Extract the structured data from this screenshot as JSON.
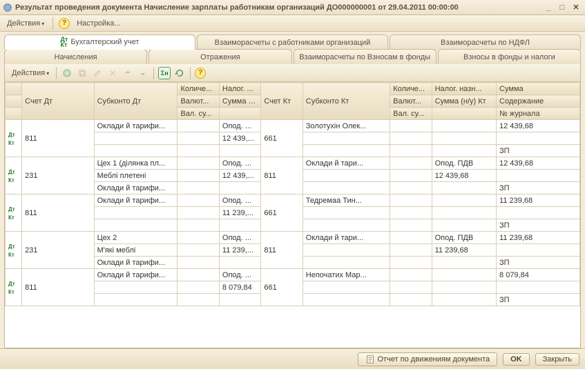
{
  "window": {
    "title": "Результат проведения документа Начисление зарплаты работникам организаций ДО000000001 от 29.04.2011 00:00:00"
  },
  "menubar": {
    "actions": "Действия",
    "settings": "Настройка..."
  },
  "tabs_top": {
    "accounting": "Бухгалтерский учет",
    "settlements": "Взаиморасчеты с работниками организаций",
    "ndfl": "Взаиморасчеты по НДФЛ"
  },
  "tabs_bottom": {
    "accruals": "Начисления",
    "reflections": "Отражения",
    "funds": "Взаиморасчеты по Взносам в фонды",
    "taxes": "Взносы в фонды и налоги"
  },
  "grid_toolbar": {
    "actions": "Действия"
  },
  "headers": {
    "r1": {
      "acct_dt": "Счет Дт",
      "sub_dt": "Субконто Дт",
      "qty": "Количе...",
      "tax": "Налог. ...",
      "acct_kt": "Счет Кт",
      "sub_kt": "Субконто Кт",
      "qty_k": "Количе...",
      "tax_k": "Налог. назн...",
      "sum": "Сумма"
    },
    "r2": {
      "cur_dt": "Валют...",
      "sum_nu_dt": "Сумма (н/у) Дт",
      "cur_kt": "Валют...",
      "sum_nu_kt": "Сумма (н/у) Кт",
      "content": "Содержание"
    },
    "r3": {
      "val_su_dt": "Вал. су...",
      "val_su_kt": "Вал. су...",
      "journal": "№ журнала"
    }
  },
  "rows": [
    {
      "acct_dt": "811",
      "sub_dt1": "Оклади й тарифи...",
      "sub_dt2": "",
      "sub_dt3": "",
      "tax1": "Опод. ...",
      "sum_nu_dt": "12 439,...",
      "acct_kt": "661",
      "sub_kt1": "Золотухін Олек...",
      "tax_k1": "",
      "sum_nu_kt": "",
      "sum": "12 439,68",
      "content": "",
      "journal": "ЗП"
    },
    {
      "acct_dt": "231",
      "sub_dt1": "Цех 1 (ділянка пл...",
      "sub_dt2": "Меблі плетені",
      "sub_dt3": "Оклади й тарифи...",
      "tax1": "Опод. ...",
      "sum_nu_dt": "12 439,...",
      "acct_kt": "811",
      "sub_kt1": "Оклади й тари...",
      "tax_k1": "Опод. ПДВ",
      "sum_nu_kt": "12 439,68",
      "sum": "12 439,68",
      "content": "",
      "journal": "ЗП"
    },
    {
      "acct_dt": "811",
      "sub_dt1": "Оклади й тарифи...",
      "sub_dt2": "",
      "sub_dt3": "",
      "tax1": "Опод. ...",
      "sum_nu_dt": "11 239,...",
      "acct_kt": "661",
      "sub_kt1": "Тедремаа Тин...",
      "tax_k1": "",
      "sum_nu_kt": "",
      "sum": "11 239,68",
      "content": "",
      "journal": "ЗП"
    },
    {
      "acct_dt": "231",
      "sub_dt1": "Цех 2",
      "sub_dt2": "М'які меблі",
      "sub_dt3": "Оклади й тарифи...",
      "tax1": "Опод. ...",
      "sum_nu_dt": "11 239,...",
      "acct_kt": "811",
      "sub_kt1": "Оклади й тари...",
      "tax_k1": "Опод. ПДВ",
      "sum_nu_kt": "11 239,68",
      "sum": "11 239,68",
      "content": "",
      "journal": "ЗП"
    },
    {
      "acct_dt": "811",
      "sub_dt1": "Оклади й тарифи...",
      "sub_dt2": "",
      "sub_dt3": "",
      "tax1": "Опод. ...",
      "sum_nu_dt": "8 079,84",
      "acct_kt": "661",
      "sub_kt1": "Непочатих Мар...",
      "tax_k1": "",
      "sum_nu_kt": "",
      "sum": "8 079,84",
      "content": "",
      "journal": "ЗП"
    }
  ],
  "bottom": {
    "report": "Отчет по движениям документа",
    "ok": "OK",
    "close": "Закрыть"
  }
}
